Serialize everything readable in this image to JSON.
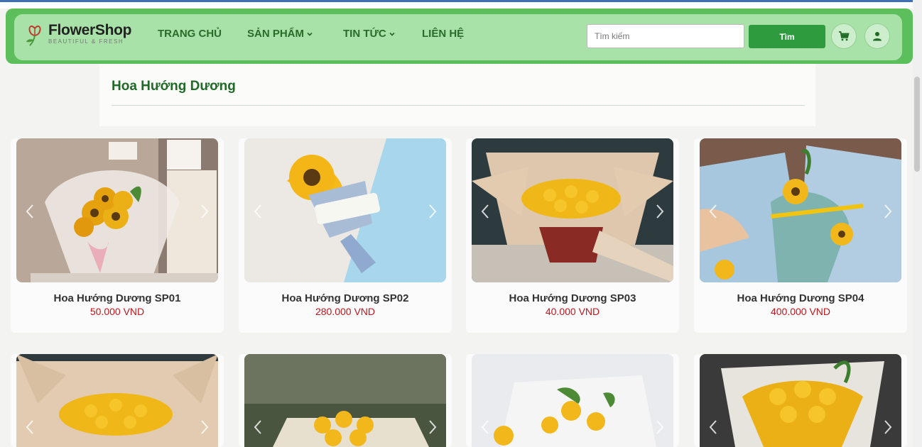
{
  "brand": {
    "name": "FlowerShop",
    "tagline": "BEAUTIFUL & FRESH"
  },
  "nav": {
    "home": "TRANG CHỦ",
    "products": "SẢN PHẨM",
    "news": "TIN TỨC",
    "contact": "LIÊN HỆ"
  },
  "search": {
    "placeholder": "Tìm kiếm",
    "button": "Tìm"
  },
  "icons": {
    "cart": "cart-icon",
    "user": "user-icon",
    "dropdown": "chevron-down-icon",
    "carousel_prev": "chevron-left-icon",
    "carousel_next": "chevron-right-icon"
  },
  "page": {
    "title": "Hoa Hướng Dương"
  },
  "products": [
    {
      "name": "Hoa Hướng Dương SP01",
      "price": "50.000 VND"
    },
    {
      "name": "Hoa Hướng Dương SP02",
      "price": "280.000 VND"
    },
    {
      "name": "Hoa Hướng Dương SP03",
      "price": "40.000 VND"
    },
    {
      "name": "Hoa Hướng Dương SP04",
      "price": "400.000 VND"
    },
    {
      "name": "",
      "price": ""
    },
    {
      "name": "",
      "price": ""
    },
    {
      "name": "",
      "price": ""
    },
    {
      "name": "",
      "price": ""
    }
  ],
  "colors": {
    "nav_outer": "#5cbf5c",
    "nav_inner": "#a9e2a9",
    "nav_text": "#2a6b2a",
    "search_button": "#2e9b3e",
    "price": "#c0161c",
    "title": "#1f6a26"
  }
}
